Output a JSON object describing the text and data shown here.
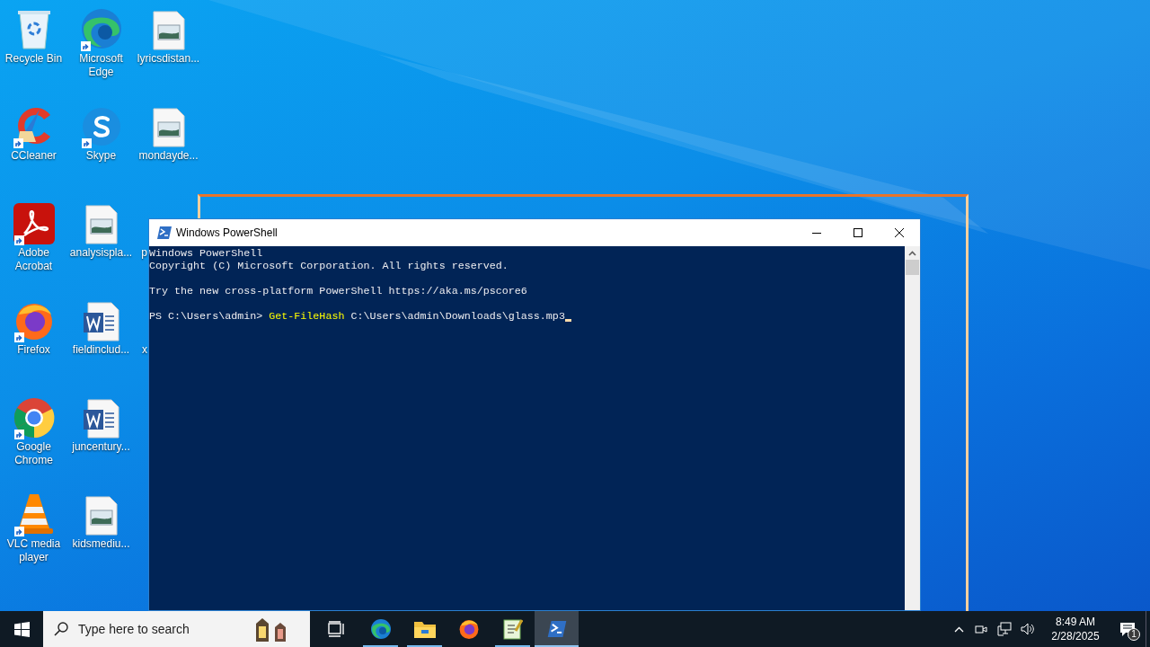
{
  "desktop": {
    "columns": [
      [
        {
          "label": "Recycle Bin",
          "kind": "recycle"
        },
        {
          "label": "CCleaner",
          "kind": "ccleaner",
          "shortcut": true
        },
        {
          "label": "Adobe Acrobat",
          "kind": "acrobat",
          "shortcut": true
        },
        {
          "label": "Firefox",
          "kind": "firefox",
          "shortcut": true
        },
        {
          "label": "Google Chrome",
          "kind": "chrome",
          "shortcut": true
        },
        {
          "label": "VLC media player",
          "kind": "vlc",
          "shortcut": true
        }
      ],
      [
        {
          "label": "Microsoft Edge",
          "kind": "edge",
          "shortcut": true
        },
        {
          "label": "Skype",
          "kind": "skype",
          "shortcut": true
        },
        {
          "label": "analysispla...",
          "kind": "image"
        },
        {
          "label": "fieldinclud...",
          "kind": "word"
        },
        {
          "label": "juncentury...",
          "kind": "word"
        },
        {
          "label": "kidsmediu...",
          "kind": "image"
        }
      ],
      [
        {
          "label": "lyricsdistan...",
          "kind": "image"
        },
        {
          "label": "mondayde...",
          "kind": "image"
        },
        {
          "label": "p",
          "kind": "covered"
        },
        {
          "label": "x",
          "kind": "covered"
        }
      ]
    ]
  },
  "window": {
    "title": "Windows PowerShell",
    "blocks": [
      [
        "Windows PowerShell",
        "Copyright (C) Microsoft Corporation. All rights reserved."
      ],
      [
        "Try the new cross-platform PowerShell https://aka.ms/pscore6"
      ]
    ],
    "prompt": {
      "prompt": "PS C:\\Users\\admin>",
      "command": "Get-FileHash",
      "argument": "C:\\Users\\admin\\Downloads\\glass.mp3"
    }
  },
  "taskbar": {
    "search_placeholder": "Type here to search",
    "apps": [
      {
        "kind": "taskview",
        "running": false,
        "active": false
      },
      {
        "kind": "edge",
        "running": true,
        "active": false
      },
      {
        "kind": "explorer",
        "running": true,
        "active": false
      },
      {
        "kind": "firefox",
        "running": false,
        "active": false
      },
      {
        "kind": "notepad",
        "running": true,
        "active": false
      },
      {
        "kind": "powershell",
        "running": true,
        "active": true
      }
    ],
    "time": "8:49 AM",
    "date": "2/28/2025",
    "notification_count": "1"
  }
}
